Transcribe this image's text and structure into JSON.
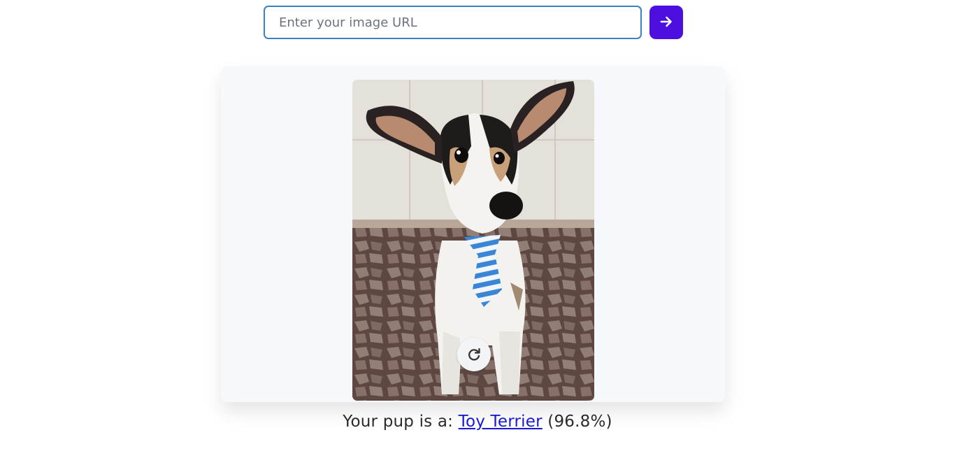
{
  "search": {
    "placeholder": "Enter your image URL",
    "value": ""
  },
  "submit": {
    "icon": "arrow-right-icon",
    "color": "#4c0fe0"
  },
  "image_card": {
    "image_description": "",
    "rotate_icon": "rotate-clockwise-icon"
  },
  "result": {
    "prefix": "Your pup is a: ",
    "breed": "Toy Terrier",
    "confidence": "(96.8%)"
  },
  "colors": {
    "accent": "#4c0fe0",
    "input_border": "#3b82c4",
    "link": "#1a1ad6",
    "card_bg": "#f6f8fb"
  }
}
